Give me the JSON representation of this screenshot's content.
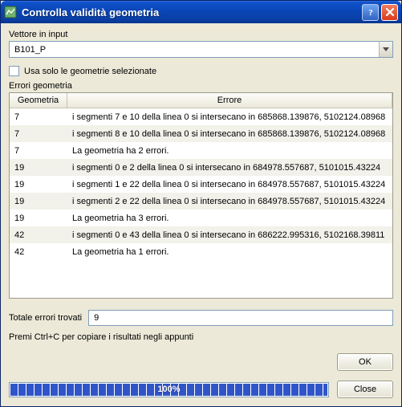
{
  "window": {
    "title": "Controlla validità geometria"
  },
  "input_vector": {
    "label": "Vettore in input",
    "value": "B101_P"
  },
  "only_selected": {
    "checked": false,
    "label": "Usa solo le geometrie selezionate"
  },
  "errors_section": {
    "label": "Errori geometria",
    "columns": {
      "geometry": "Geometria",
      "error": "Errore"
    },
    "rows": [
      {
        "geom": "7",
        "err": "i segmenti 7 e 10 della linea 0 si intersecano in 685868.139876, 5102124.08968"
      },
      {
        "geom": "7",
        "err": "i segmenti 8 e 10 della linea 0 si intersecano in 685868.139876, 5102124.08968"
      },
      {
        "geom": "7",
        "err": "La geometria ha 2 errori."
      },
      {
        "geom": "19",
        "err": "i segmenti 0 e 2 della linea 0 si intersecano in 684978.557687, 5101015.43224"
      },
      {
        "geom": "19",
        "err": "i segmenti 1 e 22 della linea 0 si intersecano in 684978.557687, 5101015.43224"
      },
      {
        "geom": "19",
        "err": "i segmenti 2 e 22 della linea 0 si intersecano in 684978.557687, 5101015.43224"
      },
      {
        "geom": "19",
        "err": "La geometria ha 3 errori."
      },
      {
        "geom": "42",
        "err": "i segmenti 0 e 43 della linea 0 si intersecano in 686222.995316, 5102168.39811"
      },
      {
        "geom": "42",
        "err": "La geometria ha 1 errori."
      }
    ]
  },
  "total": {
    "label": "Totale errori trovati",
    "value": "9"
  },
  "hint": "Premi Ctrl+C per copiare i risultati negli appunti",
  "buttons": {
    "ok": "OK",
    "close": "Close"
  },
  "progress": {
    "percent": 100,
    "text": "100%"
  }
}
